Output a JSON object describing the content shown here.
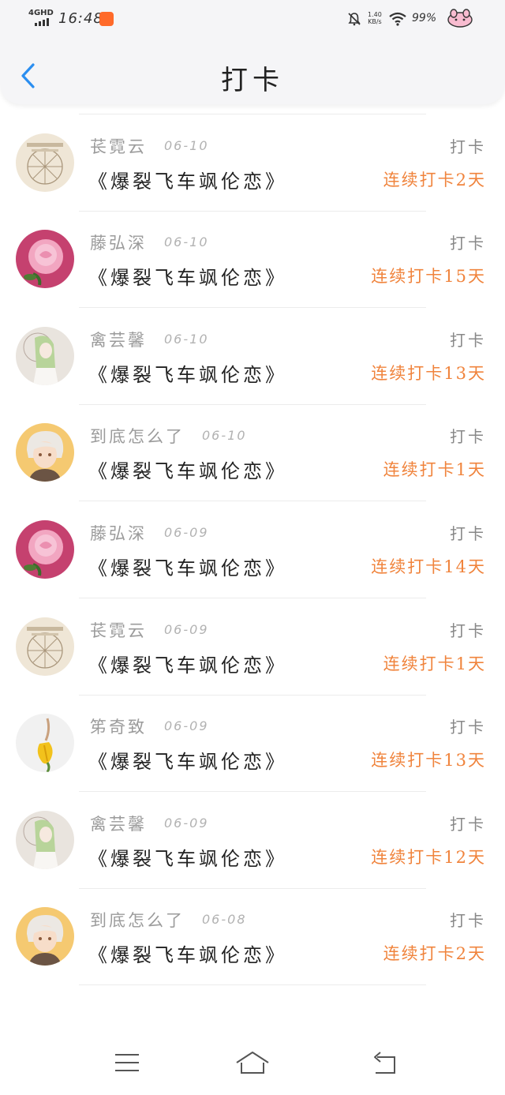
{
  "status_bar": {
    "network": "4GHD",
    "time": "16:48",
    "speed_top": "1.40",
    "speed_bottom": "KB/s",
    "battery": "99%"
  },
  "header": {
    "title": "打卡",
    "back_icon": "chevron-left-icon"
  },
  "feed": {
    "items": [
      {
        "name": "",
        "date": "",
        "book": "《爆裂飞车飒伦恋》",
        "tag": "",
        "streak": "连续打卡14天",
        "avatar": "yellow-tulip"
      },
      {
        "name": "苌霓云",
        "date": "06-10",
        "book": "《爆裂飞车飒伦恋》",
        "tag": "打卡",
        "streak": "连续打卡2天",
        "avatar": "ferris-wheel"
      },
      {
        "name": "藤弘深",
        "date": "06-10",
        "book": "《爆裂飞车飒伦恋》",
        "tag": "打卡",
        "streak": "连续打卡15天",
        "avatar": "pink-rose"
      },
      {
        "name": "禽芸馨",
        "date": "06-10",
        "book": "《爆裂飞车飒伦恋》",
        "tag": "打卡",
        "streak": "连续打卡13天",
        "avatar": "green-hair-anime"
      },
      {
        "name": "到底怎么了",
        "date": "06-10",
        "book": "《爆裂飞车飒伦恋》",
        "tag": "打卡",
        "streak": "连续打卡1天",
        "avatar": "anime-boy"
      },
      {
        "name": "藤弘深",
        "date": "06-09",
        "book": "《爆裂飞车飒伦恋》",
        "tag": "打卡",
        "streak": "连续打卡14天",
        "avatar": "pink-rose"
      },
      {
        "name": "苌霓云",
        "date": "06-09",
        "book": "《爆裂飞车飒伦恋》",
        "tag": "打卡",
        "streak": "连续打卡1天",
        "avatar": "ferris-wheel"
      },
      {
        "name": "笫奇致",
        "date": "06-09",
        "book": "《爆裂飞车飒伦恋》",
        "tag": "打卡",
        "streak": "连续打卡13天",
        "avatar": "yellow-tulip"
      },
      {
        "name": "禽芸馨",
        "date": "06-09",
        "book": "《爆裂飞车飒伦恋》",
        "tag": "打卡",
        "streak": "连续打卡12天",
        "avatar": "green-hair-anime"
      },
      {
        "name": "到底怎么了",
        "date": "06-08",
        "book": "《爆裂飞车飒伦恋》",
        "tag": "打卡",
        "streak": "连续打卡2天",
        "avatar": "anime-boy"
      }
    ]
  },
  "nav": {
    "menu_icon": "menu-icon",
    "home_icon": "home-icon",
    "back_icon": "back-icon"
  },
  "colors": {
    "accent_blue": "#2b8ef0",
    "streak_orange": "#f0843d",
    "name_gray": "#9b9b9b"
  }
}
